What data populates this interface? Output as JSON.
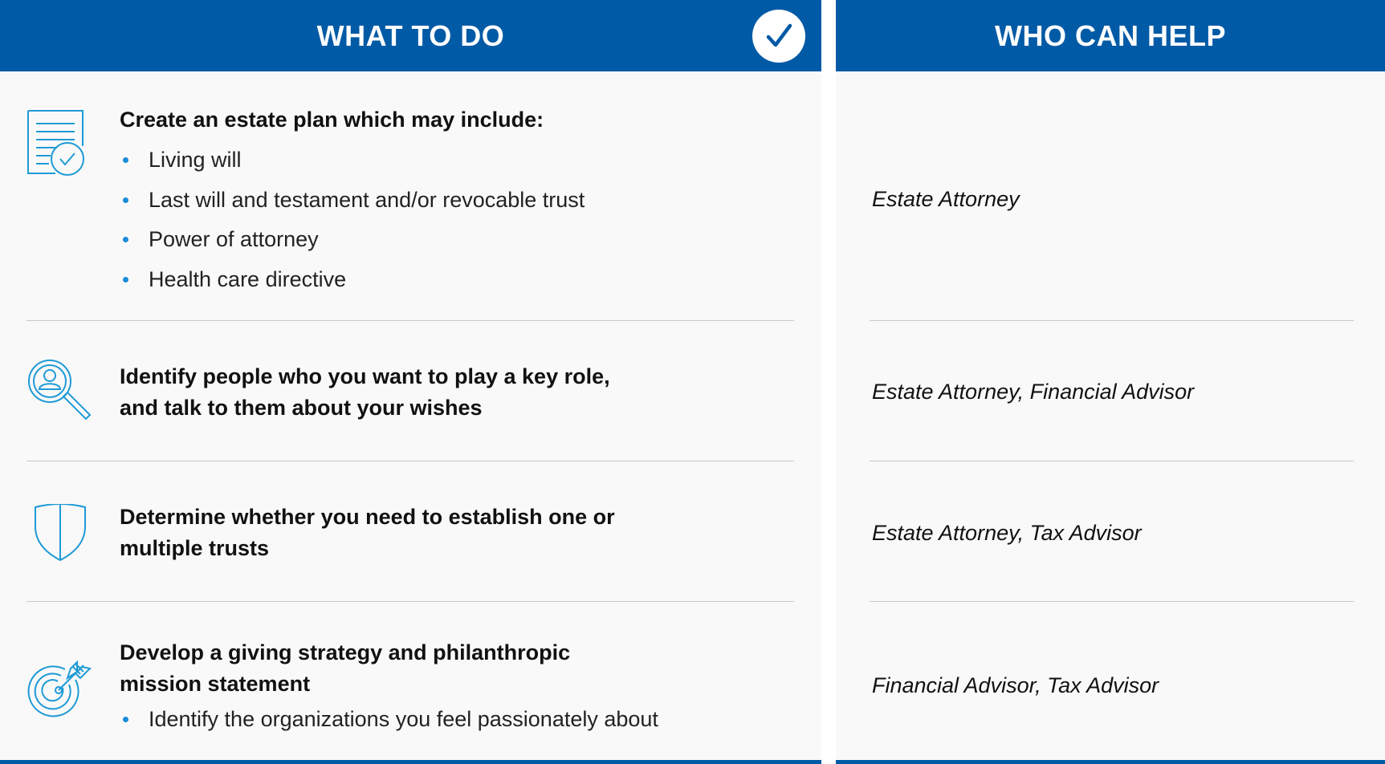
{
  "what_to_do": {
    "header": "WHAT TO DO",
    "rows": [
      {
        "icon": "document-check-icon",
        "title": "Create an estate plan which may include:",
        "bullets": [
          "Living will",
          "Last will and testament and/or revocable trust",
          "Power of attorney",
          "Health care directive"
        ]
      },
      {
        "icon": "person-search-icon",
        "title_lines": [
          "Identify people who you want to play a key role,",
          "and talk to them about your wishes"
        ]
      },
      {
        "icon": "shield-icon",
        "title_lines": [
          "Determine whether you need to establish one or",
          "multiple trusts"
        ]
      },
      {
        "icon": "target-arrow-icon",
        "title_lines": [
          "Develop a giving strategy and philanthropic",
          "mission statement"
        ],
        "bullets": [
          "Identify the organizations you feel passionately about"
        ]
      }
    ]
  },
  "who_can_help": {
    "header": "WHO CAN HELP",
    "rows": [
      "Estate Attorney",
      "Estate Attorney, Financial Advisor",
      "Estate Attorney, Tax Advisor",
      "Financial Advisor, Tax Advisor"
    ]
  },
  "colors": {
    "header_blue": "#005aa5",
    "bullet_blue": "#1a8bd8",
    "icon_blue": "#1f9ad6"
  }
}
